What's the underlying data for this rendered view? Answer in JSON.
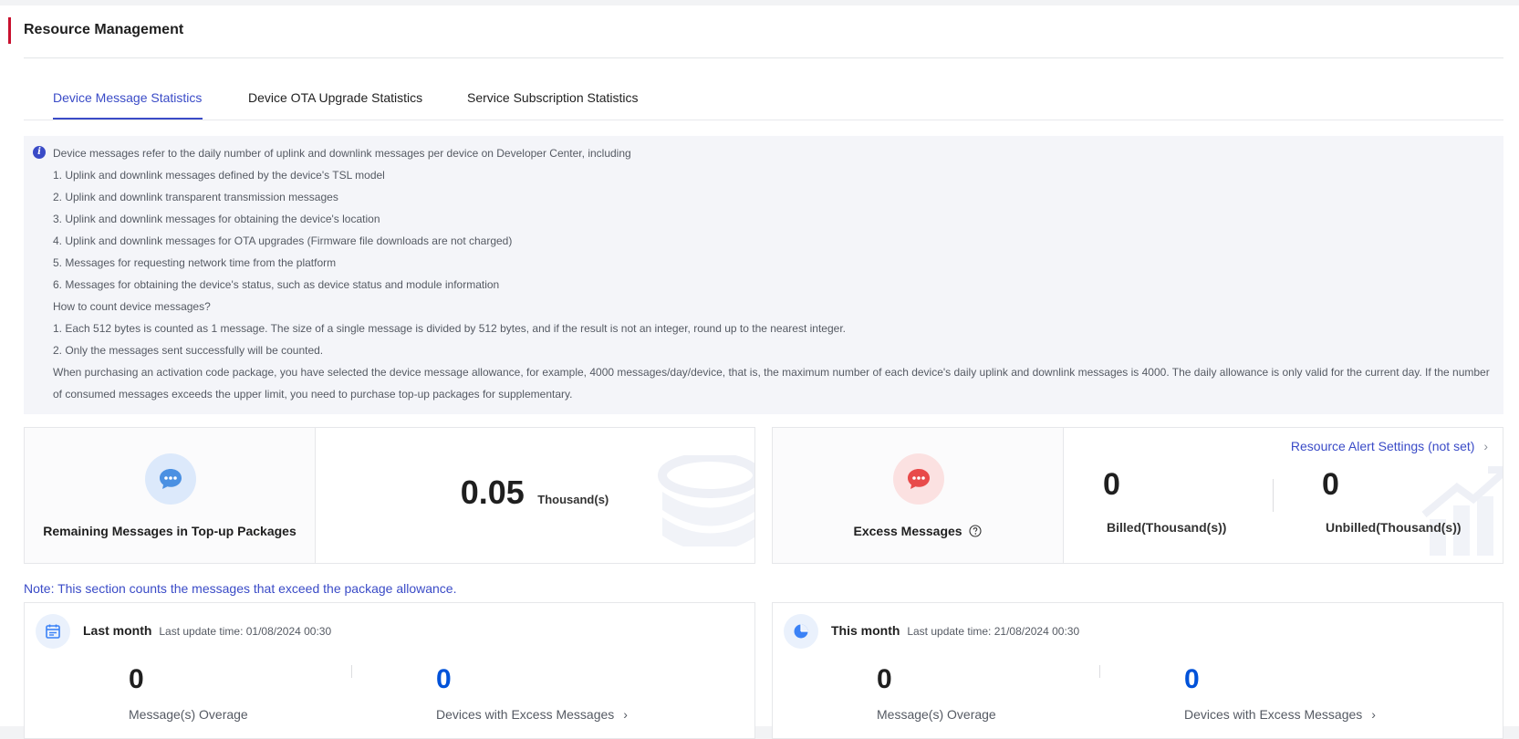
{
  "page": {
    "title": "Resource Management"
  },
  "tabs": [
    {
      "label": "Device Message Statistics",
      "active": true
    },
    {
      "label": "Device OTA Upgrade Statistics",
      "active": false
    },
    {
      "label": "Service Subscription Statistics",
      "active": false
    }
  ],
  "info": {
    "icon": "info-icon",
    "lines": [
      "Device messages refer to the daily number of uplink and downlink messages per device on Developer Center, including",
      "1. Uplink and downlink messages defined by the device's TSL model",
      "2. Uplink and downlink transparent transmission messages",
      "3. Uplink and downlink messages for obtaining the device's location",
      "4. Uplink and downlink messages for OTA upgrades (Firmware file downloads are not charged)",
      "5. Messages for requesting network time from the platform",
      "6. Messages for obtaining the device's status, such as device status and module information",
      "How to count device messages?",
      "1. Each 512 bytes is counted as 1 message. The size of a single message is divided by 512 bytes, and if the result is not an integer, round up to the nearest integer.",
      "2. Only the messages sent successfully will be counted."
    ],
    "long_paragraph": "When purchasing an activation code package, you have selected the device message allowance, for example, 4000 messages/day/device, that is, the maximum number of each device's daily uplink and downlink messages is 4000. The daily allowance is only valid for the current day. If the number of consumed messages exceeds the upper limit, you need to purchase top-up packages for supplementary."
  },
  "remaining_card": {
    "label": "Remaining Messages in Top-up Packages",
    "value": "0.05",
    "unit": "Thousand(s)",
    "icon": "chat-bubble-icon",
    "accent": "#4a90e2"
  },
  "excess_card": {
    "label": "Excess Messages",
    "help_icon": "question-circle-icon",
    "alert_link": "Resource Alert Settings (not set)",
    "billed_value": "0",
    "billed_label": "Billed(Thousand(s))",
    "unbilled_value": "0",
    "unbilled_label": "Unbilled(Thousand(s))",
    "icon": "chat-bubble-icon",
    "accent": "#e84a4a"
  },
  "note": "Note: This section counts the messages that exceed the package allowance.",
  "last_month": {
    "title": "Last month",
    "update_time": "Last update time: 01/08/2024 00:30",
    "overage_value": "0",
    "overage_label": "Message(s) Overage",
    "devices_value": "0",
    "devices_label": "Devices with Excess Messages",
    "icon": "calendar-icon"
  },
  "this_month": {
    "title": "This month",
    "update_time": "Last update time: 21/08/2024 00:30",
    "overage_value": "0",
    "overage_label": "Message(s) Overage",
    "devices_value": "0",
    "devices_label": "Devices with Excess Messages",
    "icon": "pie-chart-icon"
  },
  "colors": {
    "brand_red": "#c8102e",
    "accent_blue": "#3a4bc7",
    "link_blue": "#0052d9"
  }
}
